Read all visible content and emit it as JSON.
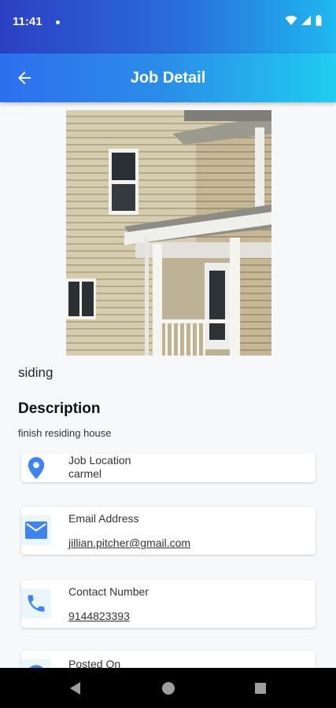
{
  "status_bar": {
    "time": "11:41"
  },
  "app_bar": {
    "title": "Job Detail"
  },
  "job": {
    "title": "siding",
    "description_heading": "Description",
    "description": "finish residing house"
  },
  "cards": {
    "location": {
      "label": "Job Location",
      "value": "carmel"
    },
    "email": {
      "label": "Email Address",
      "value": "jillian.pitcher@gmail.com"
    },
    "phone": {
      "label": "Contact Number",
      "value": "9144823393"
    },
    "posted": {
      "label": "Posted On"
    }
  },
  "colors": {
    "accent_blue": "#3f83f0",
    "app_bar_start": "#2d6fee",
    "app_bar_end": "#20cdf0",
    "icon_bg": "#e9f7fd"
  }
}
